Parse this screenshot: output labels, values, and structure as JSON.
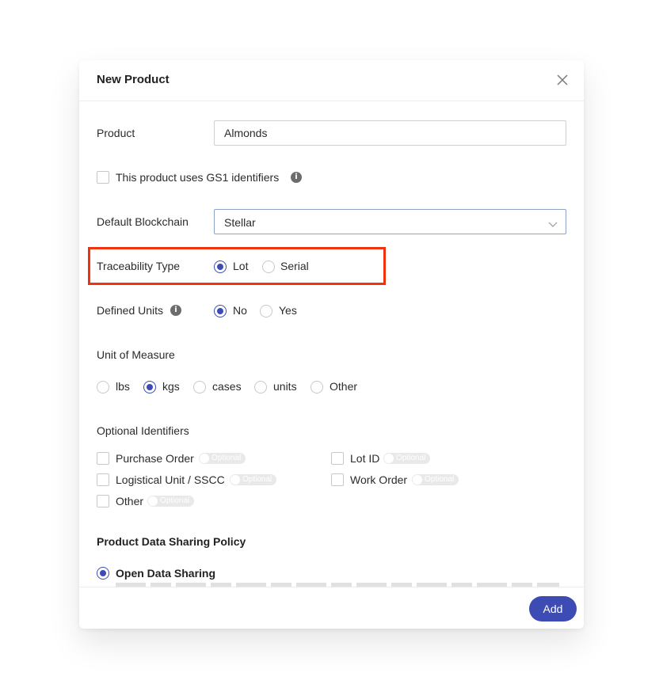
{
  "modal": {
    "title": "New Product",
    "close_icon": "close-icon"
  },
  "product": {
    "label": "Product",
    "value": "Almonds"
  },
  "gs1": {
    "label": "This product uses GS1 identifiers",
    "checked": false,
    "info_icon": "info-icon"
  },
  "blockchain": {
    "label": "Default Blockchain",
    "value": "Stellar",
    "chevron_icon": "chevron-down-icon"
  },
  "traceability": {
    "label": "Traceability Type",
    "options": [
      "Lot",
      "Serial"
    ],
    "selected": "Lot",
    "highlight_color": "#f0320f"
  },
  "defined_units": {
    "label": "Defined Units",
    "info_icon": "info-icon",
    "options": [
      "No",
      "Yes"
    ],
    "selected": "No"
  },
  "unit_of_measure": {
    "label": "Unit of Measure",
    "options": [
      "lbs",
      "kgs",
      "cases",
      "units",
      "Other"
    ],
    "selected": "kgs"
  },
  "optional_identifiers": {
    "label": "Optional Identifiers",
    "toggle_label": "Optional",
    "items": [
      "Purchase Order",
      "Lot ID",
      "Logistical Unit / SSCC",
      "Work Order",
      "Other"
    ]
  },
  "data_sharing": {
    "title": "Product Data Sharing Policy",
    "selected_option": "Open Data Sharing"
  },
  "footer": {
    "add_label": "Add"
  },
  "colors": {
    "accent": "#3d4bb5",
    "highlight": "#f0320f"
  }
}
